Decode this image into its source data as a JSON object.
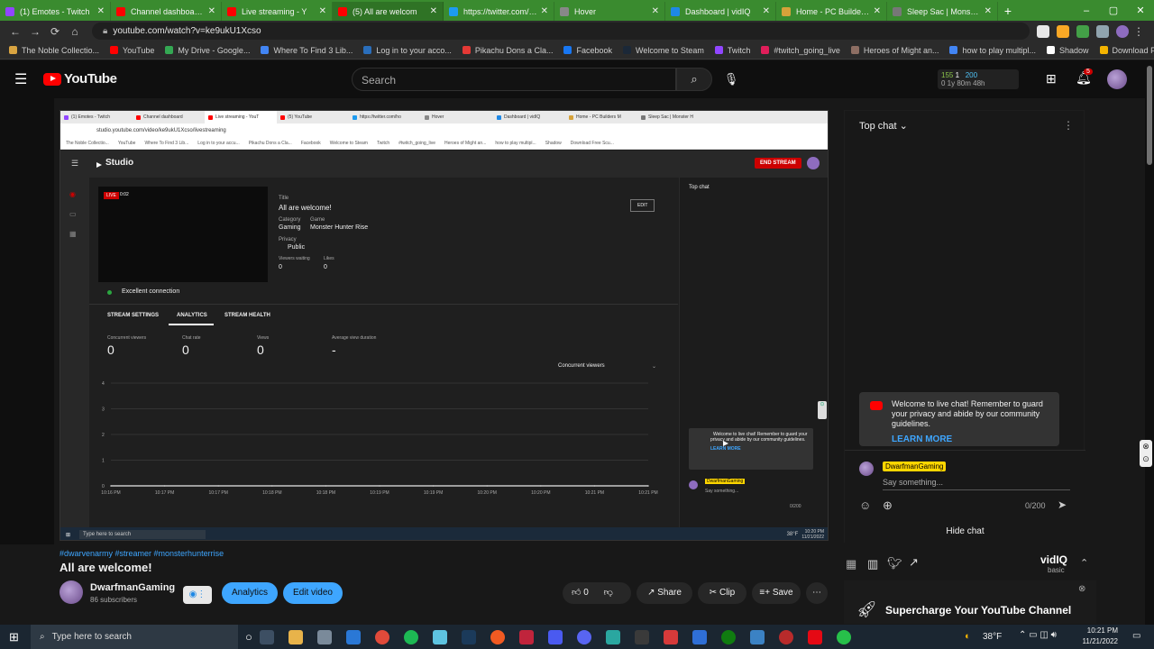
{
  "browser": {
    "tabs": [
      {
        "title": "(1) Emotes - Twitch",
        "color": "#9146ff"
      },
      {
        "title": "Channel dashboard -",
        "color": "#ff0000"
      },
      {
        "title": "Live streaming - Y",
        "color": "#ff0000"
      },
      {
        "title": "(5) All are welcom",
        "color": "#ff0000",
        "active": true
      },
      {
        "title": "https://twitter.com/ho",
        "color": "#1d9bf0"
      },
      {
        "title": "Hover",
        "color": "#888888"
      },
      {
        "title": "Dashboard | vidIQ",
        "color": "#1e88e5"
      },
      {
        "title": "Home - PC Builders M",
        "color": "#d6a23a"
      },
      {
        "title": "Sleep Sac | Monster H",
        "color": "#777777"
      }
    ],
    "url": "youtube.com/watch?v=ke9ukU1Xcso",
    "bookmarks": [
      {
        "label": "The Noble Collectio...",
        "color": "#d9a441"
      },
      {
        "label": "YouTube",
        "color": "#ff0000"
      },
      {
        "label": "My Drive - Google...",
        "color": "#34a853"
      },
      {
        "label": "Where To Find 3 Lib...",
        "color": "#4285f4"
      },
      {
        "label": "Log in to your acco...",
        "color": "#2a6ebb"
      },
      {
        "label": "Pikachu Dons a Cla...",
        "color": "#e53935"
      },
      {
        "label": "Facebook",
        "color": "#1877f2"
      },
      {
        "label": "Welcome to Steam",
        "color": "#1b2838"
      },
      {
        "label": "Twitch",
        "color": "#9146ff"
      },
      {
        "label": "#twitch_going_live",
        "color": "#e01e5a"
      },
      {
        "label": "Heroes of Might an...",
        "color": "#8d6e63"
      },
      {
        "label": "how to play multipl...",
        "color": "#4285f4"
      },
      {
        "label": "Shadow",
        "color": "#ffffff"
      },
      {
        "label": "Download Free Scu...",
        "color": "#f4b400"
      }
    ]
  },
  "youtube": {
    "logo": "YouTube",
    "search_placeholder": "Search",
    "vidiq_stats": [
      "155",
      "1",
      "200",
      "0 1y",
      "80m",
      "48h"
    ],
    "notification_count": "5"
  },
  "stream": {
    "inner_tabs": [
      "(1) Emotes - Twitch",
      "Channel dashboard",
      "Live streaming - YouT",
      "(5) YouTube",
      "https://twitter.com/ho",
      "Hover",
      "Dashboard | vidIQ",
      "Home - PC Builders M",
      "Sleep Sac | Monster H"
    ],
    "inner_url": "studio.youtube.com/video/ke9ukU1Xcso/livestreaming",
    "studio_logo": "Studio",
    "end_stream": "END STREAM",
    "live_badge": "LIVE",
    "live_time": "0:02",
    "title_label": "Title",
    "title": "All are welcome!",
    "edit": "EDIT",
    "category_label": "Category",
    "category": "Gaming",
    "game_label": "Game",
    "game": "Monster Hunter Rise",
    "privacy_label": "Privacy",
    "privacy": "Public",
    "viewers_waiting_label": "Viewers waiting",
    "viewers_waiting": "0",
    "likes_label": "Likes",
    "likes": "0",
    "connection": "Excellent connection",
    "tabs": [
      "STREAM SETTINGS",
      "ANALYTICS",
      "STREAM HEALTH"
    ],
    "metrics": [
      {
        "label": "Concurrent viewers",
        "value": "0"
      },
      {
        "label": "Chat rate",
        "value": "0"
      },
      {
        "label": "Views",
        "value": "0"
      },
      {
        "label": "Average view duration",
        "value": "-"
      }
    ],
    "dropdown": "Concurrent viewers",
    "top_chat": "Top chat",
    "chat_welcome": "Welcome to live chat! Remember to guard your privacy and abide by our community guidelines.",
    "learn_more": "LEARN MORE",
    "chat_user": "DwarfmanGaming",
    "chat_placeholder": "Say something...",
    "chat_counter": "0/200",
    "taskbar_search": "Type here to search",
    "taskbar_time": "10:20 PM",
    "taskbar_date": "11/21/2022",
    "taskbar_temp": "38°F"
  },
  "chart_data": {
    "type": "line",
    "x": [
      "10:16 PM",
      "10:17 PM",
      "10:17 PM",
      "10:18 PM",
      "10:18 PM",
      "10:19 PM",
      "10:19 PM",
      "10:20 PM",
      "10:20 PM",
      "10:21 PM",
      "10:21 PM"
    ],
    "y_ticks": [
      "4",
      "3",
      "2",
      "1",
      "0"
    ],
    "series": [
      {
        "values": [
          0,
          0,
          0,
          0,
          0,
          0,
          0,
          0,
          0,
          0,
          0
        ]
      }
    ],
    "ylim": [
      0,
      4
    ]
  },
  "chat": {
    "header": "Top chat",
    "welcome": "Welcome to live chat! Remember to guard your privacy and abide by our community guidelines.",
    "learn_more": "LEARN MORE",
    "user": "DwarfmanGaming",
    "placeholder": "Say something...",
    "counter": "0/200",
    "hide": "Hide chat"
  },
  "video_info": {
    "tags": "#dwarvenarmy #streamer #monsterhunterrise",
    "title": "All are welcome!",
    "channel": "DwarfmanGaming",
    "subscribers": "86 subscribers",
    "analytics": "Analytics",
    "edit_video": "Edit video",
    "likes": "0",
    "share": "Share",
    "clip": "Clip",
    "save": "Save"
  },
  "vidiq": {
    "brand": "vidIQ",
    "tier": "basic",
    "promo": "Supercharge Your YouTube Channel"
  },
  "taskbar": {
    "search": "Type here to search",
    "temp": "38°F",
    "time": "10:21 PM",
    "date": "11/21/2022"
  }
}
